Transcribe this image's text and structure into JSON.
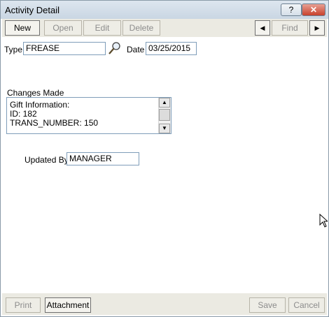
{
  "window": {
    "title": "Activity Detail",
    "help_label": "?",
    "close_label": "✕"
  },
  "toolbar": {
    "new": "New",
    "open": "Open",
    "edit": "Edit",
    "delete": "Delete",
    "prev": "◀",
    "find": "Find",
    "next": "▶"
  },
  "form": {
    "type_label": "Type",
    "type_value": "FREASE",
    "date_label": "Date",
    "date_value": "03/25/2015",
    "changes_label": "Changes Made",
    "changes_lines": [
      "Gift Information:",
      "ID: 182",
      "TRANS_NUMBER: 150"
    ],
    "updated_by_label": "Updated By",
    "updated_by_value": "MANAGER"
  },
  "bottom": {
    "print": "Print",
    "attachment": "Attachment",
    "save": "Save",
    "cancel": "Cancel"
  },
  "icons": {
    "lookup": "magnifier-icon",
    "scroll_up": "arrow-up-icon",
    "scroll_down": "arrow-down-icon"
  }
}
